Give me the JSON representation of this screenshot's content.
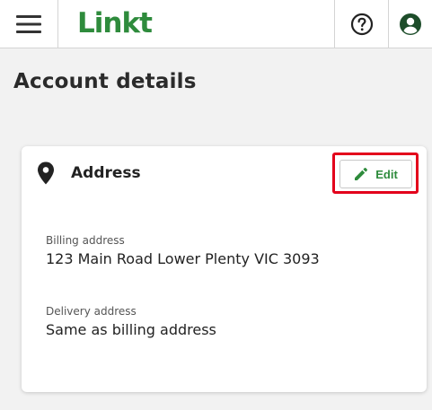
{
  "header": {
    "logo_text": "Linkt",
    "logo_color": "#2e8b3c",
    "menu_icon": "hamburger-icon",
    "help_icon": "question-circle-icon",
    "account_icon": "account-circle-icon"
  },
  "page": {
    "title": "Account details"
  },
  "address_card": {
    "icon": "location-pin-icon",
    "title": "Address",
    "edit_label": "Edit",
    "edit_icon": "pencil-icon",
    "highlight_color": "#e3001b",
    "billing_label": "Billing address",
    "billing_value": "123 Main Road Lower Plenty VIC 3093",
    "delivery_label": "Delivery address",
    "delivery_value": "Same as billing address"
  }
}
